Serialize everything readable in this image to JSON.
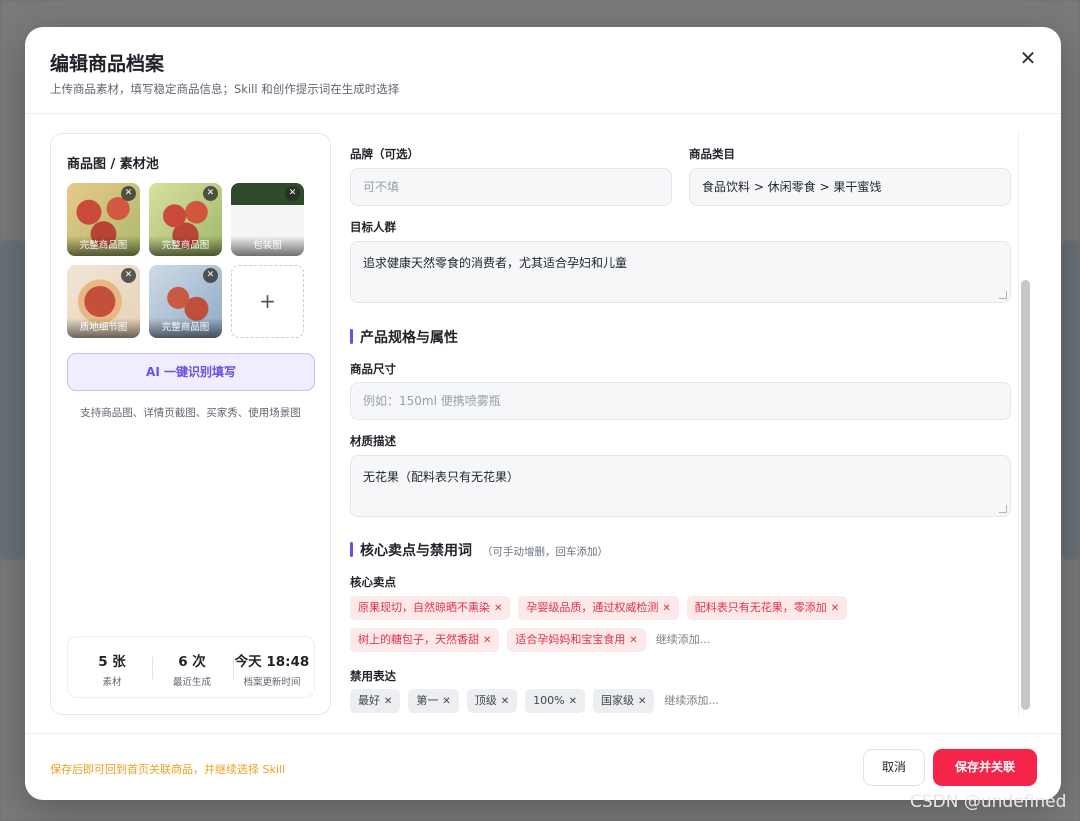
{
  "modal": {
    "title": "编辑商品档案",
    "subtitle": "上传商品素材，填写稳定商品信息；Skill 和创作提示词在生成时选择",
    "close_icon": "close-icon"
  },
  "left": {
    "title": "商品图 / 素材池",
    "thumbs": [
      {
        "label": "完整商品图"
      },
      {
        "label": "完整商品图"
      },
      {
        "label": "包装图"
      },
      {
        "label": "质地细节图"
      },
      {
        "label": "完整商品图"
      }
    ],
    "add_symbol": "+",
    "ai_button": "AI 一键识别填写",
    "support_hint": "支持商品图、详情页截图、买家秀、使用场景图",
    "stats": [
      {
        "value": "5 张",
        "label": "素材"
      },
      {
        "value": "6 次",
        "label": "最近生成"
      },
      {
        "value": "今天 18:48",
        "label": "档案更新时间"
      }
    ]
  },
  "form": {
    "brand_label": "品牌（可选）",
    "brand_placeholder": "可不填",
    "category_label": "商品类目",
    "category_value": "食品饮料 > 休闲零食 > 果干蜜饯",
    "audience_label": "目标人群",
    "audience_value": "追求健康天然零食的消费者，尤其适合孕妇和儿童",
    "spec_section": "产品规格与属性",
    "size_label": "商品尺寸",
    "size_placeholder": "例如：150ml 便携喷雾瓶",
    "material_label": "材质描述",
    "material_value": "无花果（配料表只有无花果）",
    "selling_section": "核心卖点与禁用词",
    "selling_section_note": "（可手动增删，回车添加）",
    "selling_label": "核心卖点",
    "selling_points": [
      "原果现切，自然晾晒不熏染",
      "孕婴级品质，通过权威检测",
      "配料表只有无花果，零添加",
      "树上的糖包子，天然香甜",
      "适合孕妈妈和宝宝食用"
    ],
    "selling_more": "继续添加...",
    "banned_label": "禁用表达",
    "banned_words": [
      "最好",
      "第一",
      "顶级",
      "100%",
      "国家级"
    ],
    "banned_more": "继续添加..."
  },
  "footer": {
    "hint": "保存后即可回到首页关联商品，并继续选择 Skill",
    "cancel": "取消",
    "save": "保存并关联"
  },
  "watermark": "CSDN @undefined",
  "colors": {
    "accent": "#6a4fe0",
    "danger": "#f5244a",
    "hint": "#f0a020"
  }
}
